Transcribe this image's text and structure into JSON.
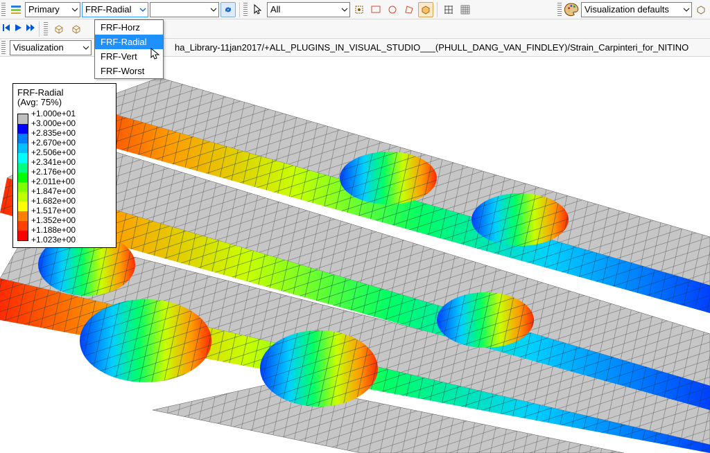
{
  "toolbar": {
    "variable_combo": "Primary",
    "field_combo": "FRF-Radial",
    "component_combo": "",
    "selection_combo": "All",
    "render_combo": "Visualization defaults"
  },
  "dropdown": {
    "items": [
      "FRF-Horz",
      "FRF-Radial",
      "FRF-Vert",
      "FRF-Worst"
    ],
    "selected": "FRF-Radial"
  },
  "module_combo": "Visualization",
  "breadcrumb": "ha_Library-11jan2017/+ALL_PLUGINS_IN_VISUAL_STUDIO___(PHULL_DANG_VAN_FINDLEY)/Strain_Carpinteri_for_NITINO",
  "legend": {
    "title": "FRF-Radial",
    "avg": "(Avg: 75%)",
    "colors": [
      "#bfbfbf",
      "#0000ff",
      "#0080ff",
      "#00c0ff",
      "#00ffff",
      "#00ff80",
      "#00ff00",
      "#80ff00",
      "#c0ff00",
      "#ffff00",
      "#ff8000",
      "#ff4000",
      "#ff0000"
    ],
    "values": [
      "+1.000e+01",
      "+3.000e+00",
      "+2.835e+00",
      "+2.670e+00",
      "+2.506e+00",
      "+2.341e+00",
      "+2.176e+00",
      "+2.011e+00",
      "+1.847e+00",
      "+1.682e+00",
      "+1.517e+00",
      "+1.352e+00",
      "+1.188e+00",
      "+1.023e+00"
    ]
  }
}
